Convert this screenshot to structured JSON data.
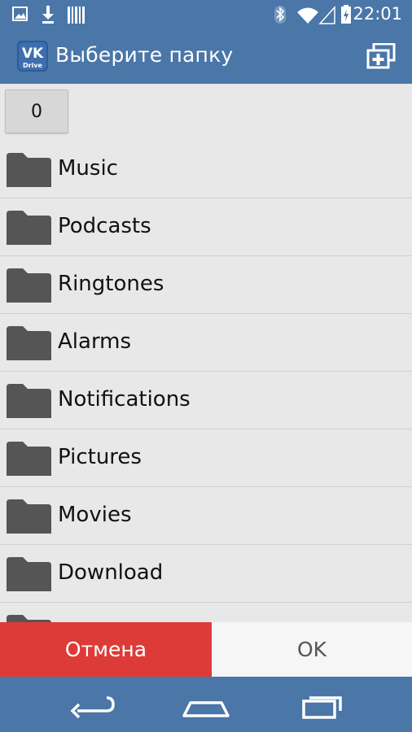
{
  "status_bar": {
    "time": "22:01",
    "left_icons": [
      "image-icon",
      "download-icon",
      "barcode-icon"
    ],
    "right_icons": [
      "bluetooth-icon",
      "wifi-icon",
      "signal-icon",
      "battery-charging-icon"
    ]
  },
  "action_bar": {
    "app_icon_text": "Drive",
    "title": "Выберите папку"
  },
  "breadcrumb": {
    "label": "0"
  },
  "folders": [
    {
      "label": "Music"
    },
    {
      "label": "Podcasts"
    },
    {
      "label": "Ringtones"
    },
    {
      "label": "Alarms"
    },
    {
      "label": "Notifications"
    },
    {
      "label": "Pictures"
    },
    {
      "label": "Movies"
    },
    {
      "label": "Download"
    },
    {
      "label": ""
    }
  ],
  "buttons": {
    "cancel": "Отмена",
    "ok": "OK"
  },
  "colors": {
    "bar": "#4a76a8",
    "cancel": "#dd3b38",
    "ok": "#f6f6f6",
    "folder": "#555555"
  }
}
